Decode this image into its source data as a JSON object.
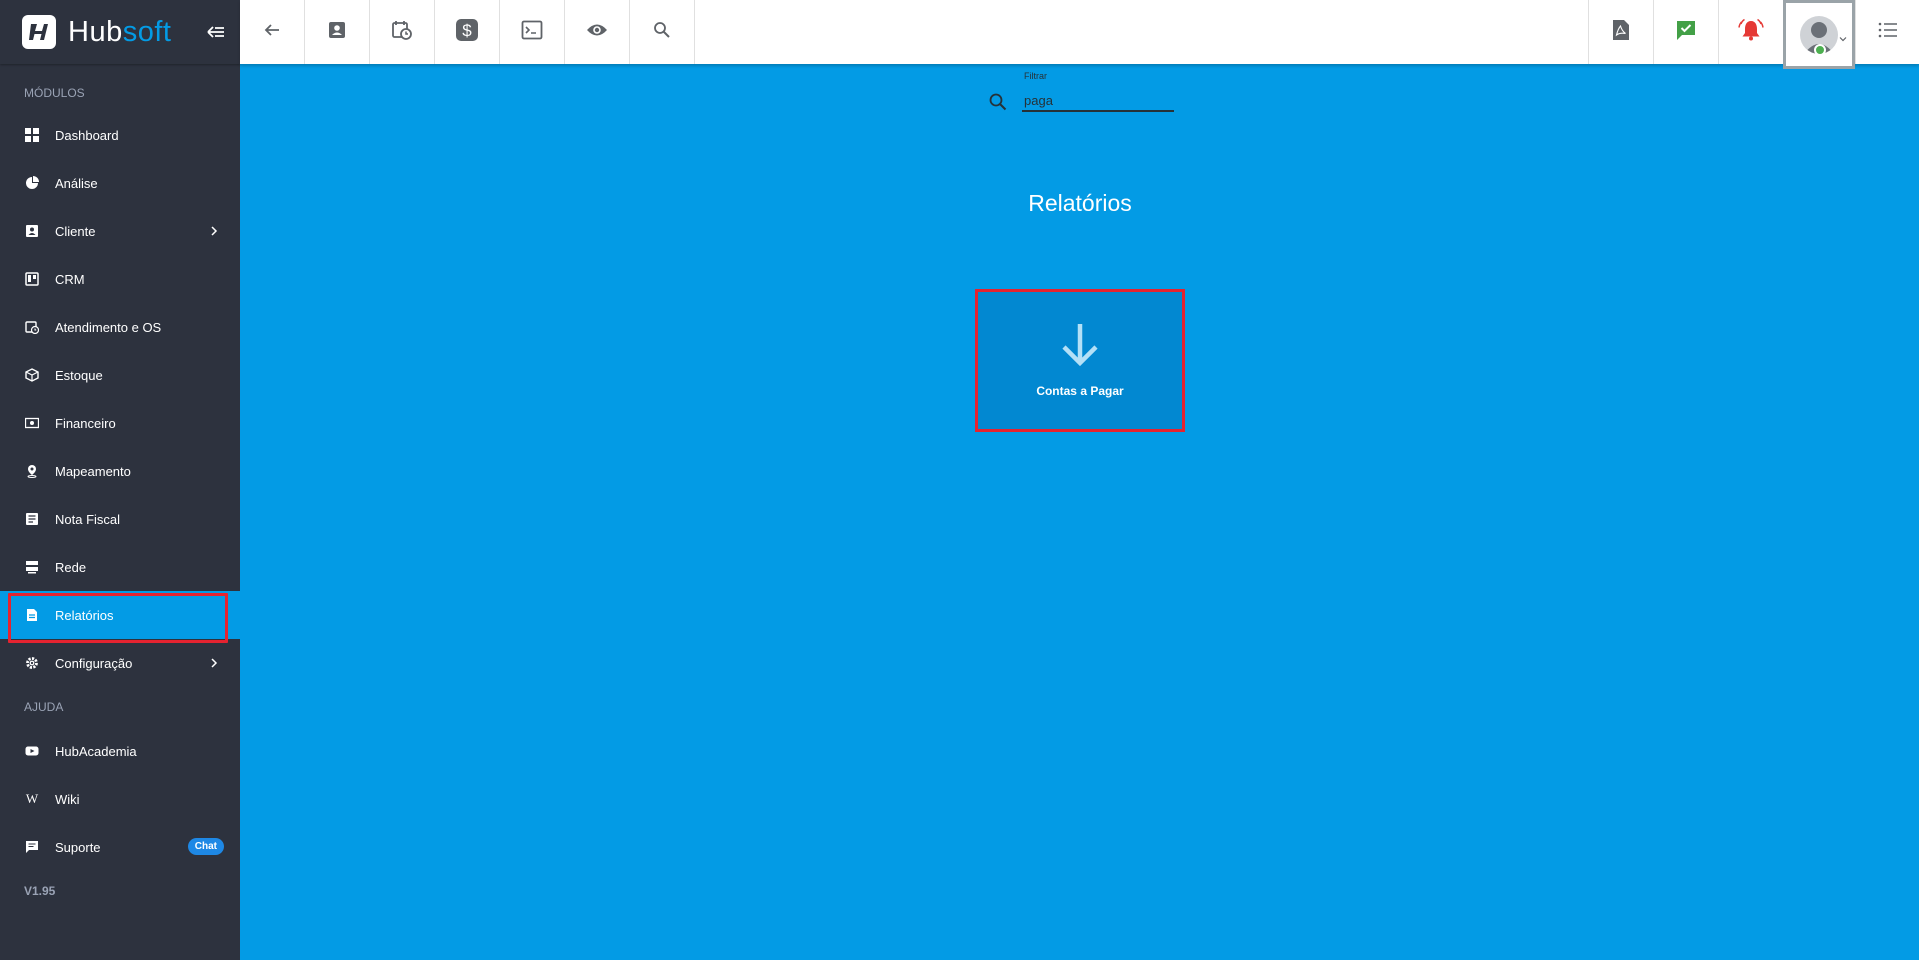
{
  "app": {
    "brand_hub": "Hub",
    "brand_soft": "soft"
  },
  "sidebar": {
    "section_modules": "MÓDULOS",
    "items": [
      {
        "label": "Dashboard",
        "icon": "dashboard-icon"
      },
      {
        "label": "Análise",
        "icon": "pie-chart-icon"
      },
      {
        "label": "Cliente",
        "icon": "contact-card-icon",
        "has_children": true
      },
      {
        "label": "CRM",
        "icon": "kanban-icon"
      },
      {
        "label": "Atendimento e OS",
        "icon": "calendar-clock-icon"
      },
      {
        "label": "Estoque",
        "icon": "package-icon"
      },
      {
        "label": "Financeiro",
        "icon": "money-icon"
      },
      {
        "label": "Mapeamento",
        "icon": "map-pin-icon"
      },
      {
        "label": "Nota Fiscal",
        "icon": "invoice-icon"
      },
      {
        "label": "Rede",
        "icon": "server-icon"
      },
      {
        "label": "Relatórios",
        "icon": "report-icon",
        "active": true
      },
      {
        "label": "Configuração",
        "icon": "gear-icon",
        "has_children": true
      }
    ],
    "section_help": "AJUDA",
    "help_items": [
      {
        "label": "HubAcademia",
        "icon": "youtube-icon"
      },
      {
        "label": "Wiki",
        "icon": "wiki-icon"
      },
      {
        "label": "Suporte",
        "icon": "chat-icon",
        "badge": "Chat"
      }
    ],
    "version": "V1.95"
  },
  "topbar": {
    "left_buttons": [
      "back-arrow-icon",
      "contact-card-icon",
      "calendar-clock-icon",
      "dollar-icon",
      "terminal-icon",
      "eye-icon",
      "search-icon"
    ],
    "right_buttons": [
      "pdf-icon",
      "chat-check-icon",
      "alarm-bell-icon",
      "avatar",
      "list-menu-icon"
    ]
  },
  "main": {
    "filter_label": "Filtrar",
    "filter_value": "paga",
    "title": "Relatórios",
    "cards": [
      {
        "label": "Contas a Pagar",
        "icon": "arrow-down-icon"
      }
    ]
  },
  "colors": {
    "primary": "#039be5",
    "sidebar": "#2d323e",
    "highlight": "#e52330",
    "card": "#0288d1"
  }
}
